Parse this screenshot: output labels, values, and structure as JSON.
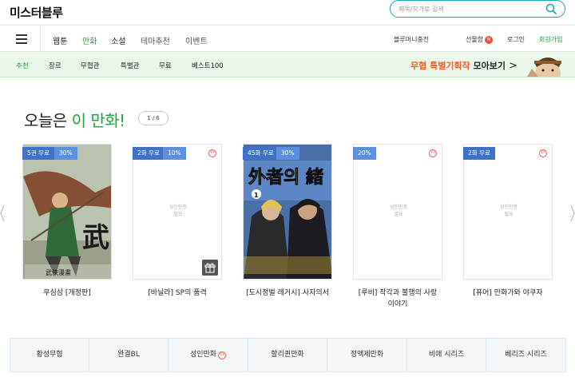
{
  "header": {
    "logo": "미스터블루",
    "search_placeholder": "제목/작가로 검색"
  },
  "nav": {
    "tabs": [
      "웹툰",
      "만화",
      "소설",
      "테마추천",
      "이벤트"
    ],
    "active_tab": "만화",
    "right": {
      "charge": "블루머니충전",
      "gift": "선물함",
      "gift_badge": "N",
      "login": "로그인",
      "join": "회원가입"
    }
  },
  "subnav": {
    "tabs": [
      "추천",
      "장르",
      "무협관",
      "특별관",
      "무료",
      "베스트100"
    ],
    "active_tab": "추천",
    "promo_highlight": "무협 특별기획작",
    "promo_text": "모아보기",
    "promo_arrow": ">"
  },
  "section": {
    "title_prefix": "오늘은",
    "title_highlight": "이 만화!",
    "pager": "1 / 6"
  },
  "cards": [
    {
      "free": "5권 무료",
      "discount": "30%",
      "title": "무심삼 [개정판]",
      "adult": false,
      "cover_text": "武",
      "cover_sub": "武俠漫畫"
    },
    {
      "free": "2화 무료",
      "discount": "10%",
      "title": "[바닐라] SP의 품격",
      "adult": true,
      "adult_msg": [
        "성인인증",
        "필요"
      ],
      "age": "19",
      "gift": true
    },
    {
      "free": "45화 무료",
      "discount": "30%",
      "title": "[도시정벌 레거시] 사자의서",
      "adult": false,
      "cover_text": "外者의 緒",
      "cover_volume": "1"
    },
    {
      "free": "",
      "discount": "20%",
      "title_lines": [
        "[루비] 착각과 불행의 사랑",
        "이야기"
      ],
      "adult": true,
      "adult_msg": [
        "성인인증",
        "필요"
      ],
      "age": "19"
    },
    {
      "free": "2화 무료",
      "discount": "",
      "title": "[퓨어] 만화가와 야쿠자",
      "adult": true,
      "adult_msg": [
        "성인인증",
        "필요"
      ],
      "age": "19"
    }
  ],
  "categories": [
    {
      "label": "황성무협"
    },
    {
      "label": "완결BL"
    },
    {
      "label": "성인만화",
      "age": "19"
    },
    {
      "label": "할리퀸만화"
    },
    {
      "label": "정액제만화"
    },
    {
      "label": "비애 시리즈"
    },
    {
      "label": "베리즈 시리즈"
    }
  ],
  "colors": {
    "accent_green": "#1f9a3a",
    "search_border": "#18a6b8",
    "tag_blue": "#3d72c8",
    "promo_orange": "#e8602a"
  }
}
